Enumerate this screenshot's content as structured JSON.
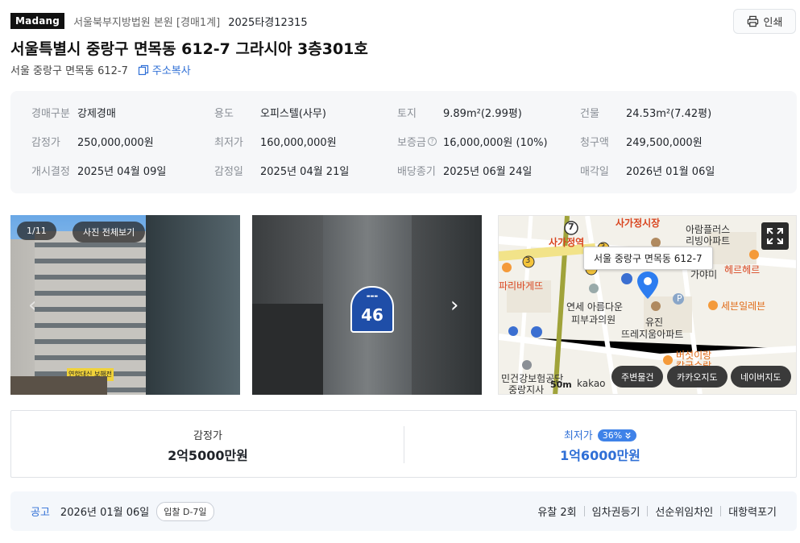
{
  "header": {
    "logo": "Madang",
    "court": "서울북부지방법원 본원 [경매1계]",
    "case_no": "2025타경12315",
    "print_label": "인쇄"
  },
  "property": {
    "title": "서울특별시 중랑구 면목동 612-7 그라시아 3층301호",
    "address": "서울 중랑구 면목동 612-7",
    "copy_label": "주소복사"
  },
  "info": [
    {
      "label": "경매구분",
      "value": "강제경매"
    },
    {
      "label": "용도",
      "value": "오피스텔(사무)"
    },
    {
      "label": "토지",
      "value": "9.89m²(2.99평)"
    },
    {
      "label": "건물",
      "value": "24.53m²(7.42평)"
    },
    {
      "label": "감정가",
      "value": "250,000,000원"
    },
    {
      "label": "최저가",
      "value": "160,000,000원"
    },
    {
      "label": "보증금",
      "value": "16,000,000원 (10%)",
      "help": "?"
    },
    {
      "label": "청구액",
      "value": "249,500,000원"
    },
    {
      "label": "개시결정",
      "value": "2025년 04월 09일"
    },
    {
      "label": "감정일",
      "value": "2025년 04월 21일"
    },
    {
      "label": "배당종기",
      "value": "2025년 06월 24일"
    },
    {
      "label": "매각일",
      "value": "2026년 01월 06일"
    }
  ],
  "photos": {
    "counter": "1/11",
    "view_all": "사진 전체보기",
    "plate_number": "46",
    "store_sign": "연합대신 보해전"
  },
  "map": {
    "tooltip": "서울 중랑구 면목동 612-7",
    "labels": {
      "station": "사가정역",
      "market": "사가정시장",
      "apt1a": "아람플러스",
      "apt1b": "리빙아파트",
      "hereherre": "헤르헤르",
      "gayami": "가야미",
      "sebon": "세븐일레븐",
      "clinic1": "연세 아름다운",
      "clinic2": "피부과의원",
      "yujin1": "유진",
      "yujin2": "뜨레지움아파트",
      "mushroom1": "버섯이랑",
      "mushroom2": "칼국수랑",
      "nhis1": "민건강보험공단",
      "nhis2": "중랑지사",
      "bakery": "파리바게뜨",
      "line7": "7",
      "line3a": "3",
      "line3b": "3",
      "line1": "1",
      "parking": "P"
    },
    "scale": "50m",
    "provider": "kakao",
    "buttons": [
      "주변물건",
      "카카오지도",
      "네이버지도"
    ]
  },
  "prices": {
    "appraisal_label": "감정가",
    "appraisal_value": "2억5000만원",
    "minimum_label": "최저가",
    "minimum_pct": "36%",
    "minimum_value": "1억6000만원"
  },
  "notice": {
    "label": "공고",
    "date": "2026년 01월 06일",
    "dday": "입찰 D-7일",
    "tags": [
      "유찰 2회",
      "임차권등기",
      "선순위임차인",
      "대항력포기"
    ]
  }
}
